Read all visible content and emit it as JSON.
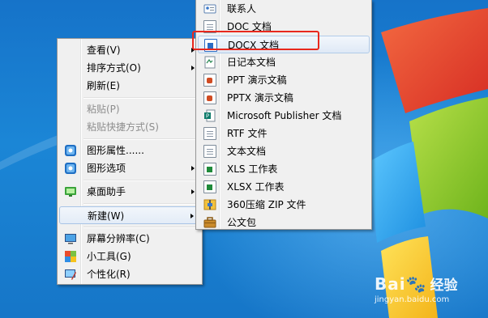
{
  "context_menu": {
    "items": [
      {
        "label": "查看(V)",
        "has_submenu": true,
        "disabled": false
      },
      {
        "label": "排序方式(O)",
        "has_submenu": true,
        "disabled": false
      },
      {
        "label": "刷新(E)",
        "has_submenu": false,
        "disabled": false
      },
      {
        "label": "粘贴(P)",
        "has_submenu": false,
        "disabled": true
      },
      {
        "label": "粘贴快捷方式(S)",
        "has_submenu": false,
        "disabled": true
      },
      {
        "label": "图形属性......",
        "has_submenu": false,
        "disabled": false
      },
      {
        "label": "图形选项",
        "has_submenu": true,
        "disabled": false
      },
      {
        "label": "桌面助手",
        "has_submenu": true,
        "disabled": false
      },
      {
        "label": "新建(W)",
        "has_submenu": true,
        "disabled": false,
        "active": true
      },
      {
        "label": "屏幕分辨率(C)",
        "has_submenu": false,
        "disabled": false
      },
      {
        "label": "小工具(G)",
        "has_submenu": false,
        "disabled": false
      },
      {
        "label": "个性化(R)",
        "has_submenu": false,
        "disabled": false
      }
    ]
  },
  "new_submenu": {
    "items": [
      {
        "label": "联系人",
        "icon": "contact-card-icon"
      },
      {
        "label": "DOC 文档",
        "icon": "doc-document-icon"
      },
      {
        "label": "DOCX 文档",
        "icon": "docx-document-icon",
        "highlighted": true
      },
      {
        "label": "日记本文档",
        "icon": "journal-document-icon"
      },
      {
        "label": "PPT 演示文稿",
        "icon": "ppt-presentation-icon"
      },
      {
        "label": "PPTX 演示文稿",
        "icon": "pptx-presentation-icon"
      },
      {
        "label": "Microsoft Publisher 文档",
        "icon": "publisher-document-icon"
      },
      {
        "label": "RTF 文件",
        "icon": "rtf-document-icon"
      },
      {
        "label": "文本文档",
        "icon": "text-document-icon"
      },
      {
        "label": "XLS 工作表",
        "icon": "xls-worksheet-icon"
      },
      {
        "label": "XLSX 工作表",
        "icon": "xlsx-worksheet-icon"
      },
      {
        "label": "360压缩 ZIP 文件",
        "icon": "zip-archive-icon"
      },
      {
        "label": "公文包",
        "icon": "briefcase-icon"
      }
    ]
  },
  "watermark": {
    "brand": "Bai",
    "brand2": "经验",
    "url": "jingyan.baidu.com"
  },
  "colors": {
    "highlight_border": "#e8281e",
    "desktop_blue": "#1b86d6"
  }
}
